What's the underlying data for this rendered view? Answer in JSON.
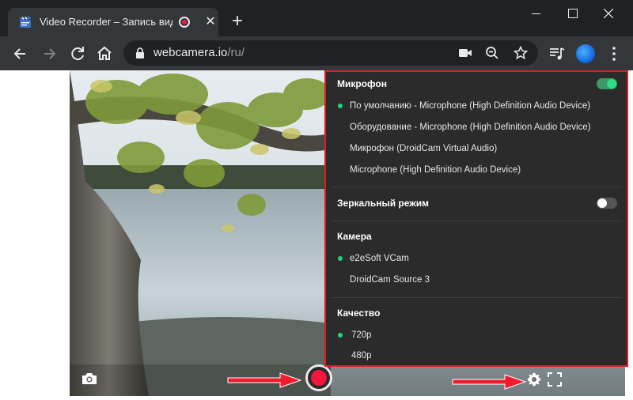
{
  "browser": {
    "tab_title": "Video Recorder – Запись видео",
    "new_tab_label": "+",
    "tab_close_label": "✕",
    "url_host": "webcamera.io",
    "url_path": "/ru/"
  },
  "settings": {
    "microphone": {
      "title": "Микрофон",
      "enabled": true,
      "options": [
        {
          "label": "По умолчанию - Microphone (High Definition Audio Device)",
          "selected": true
        },
        {
          "label": "Оборудование - Microphone (High Definition Audio Device)",
          "selected": false
        },
        {
          "label": "Микрофон (DroidCam Virtual Audio)",
          "selected": false
        },
        {
          "label": "Microphone (High Definition Audio Device)",
          "selected": false
        }
      ]
    },
    "mirror": {
      "title": "Зеркальный режим",
      "enabled": false
    },
    "camera": {
      "title": "Камера",
      "options": [
        {
          "label": "e2eSoft VCam",
          "selected": true
        },
        {
          "label": "DroidCam Source 3",
          "selected": false
        }
      ]
    },
    "quality": {
      "title": "Качество",
      "options": [
        {
          "label": "720p",
          "selected": true
        },
        {
          "label": "480p",
          "selected": false
        }
      ]
    }
  },
  "colors": {
    "accent_green": "#1fd67a",
    "record_red": "#f2153c",
    "highlight_red": "#e01b24"
  }
}
